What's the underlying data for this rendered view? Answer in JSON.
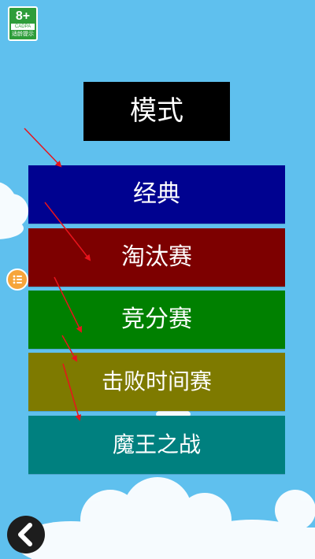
{
  "age_rating": {
    "age": "8+",
    "org": "CADPA",
    "tip": "适龄提示"
  },
  "title": "模式",
  "modes": [
    {
      "label": "经典",
      "color": "#000290"
    },
    {
      "label": "淘汰赛",
      "color": "#7d0000"
    },
    {
      "label": "竞分赛",
      "color": "#008000"
    },
    {
      "label": "击败时间赛",
      "color": "#7e7a00"
    },
    {
      "label": "魔王之战",
      "color": "#00807f"
    }
  ],
  "icons": {
    "floating_menu": "list-icon",
    "back": "chevron-left-icon"
  },
  "colors": {
    "background": "#5fc0ee",
    "annotation_arrow": "#e8141c",
    "menu_accent": "#f6a53b"
  }
}
